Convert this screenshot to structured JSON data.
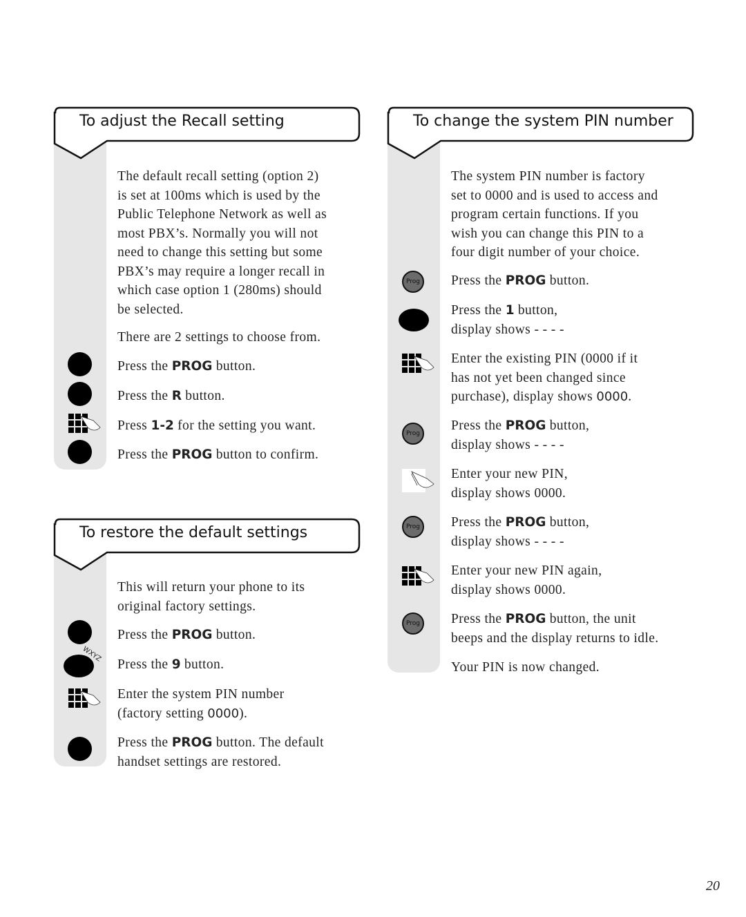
{
  "page_number": "20",
  "left_column": {
    "recall": {
      "title": "To adjust the Recall setting",
      "intro": "The default recall setting (option 2) is set at 100ms which is used by the Public Telephone Network as well as most PBX’s. Normally you will not need to change this setting but some PBX’s may require a longer recall in which case option 1 (280ms) should be selected.",
      "intro_lines": [
        "The default recall setting (option 2)",
        "is set at 100ms which is used by the",
        "Public Telephone Network as well as",
        "most PBX’s. Normally you will not",
        "need to change this setting but some",
        "PBX’s may require a longer recall in",
        "which case option 1 (280ms) should",
        "be selected."
      ],
      "note": "There are 2 settings to choose from.",
      "steps": [
        {
          "icon": "black-button-icon",
          "pre": "Press the ",
          "bold": "PROG",
          "post": " button."
        },
        {
          "icon": "black-button-icon",
          "pre": "Press the ",
          "bold": "R",
          "post": " button."
        },
        {
          "icon": "keypad-icon",
          "pre": "Press ",
          "bold": "1-2",
          "post": " for the setting you want."
        },
        {
          "icon": "black-button-icon",
          "pre": "Press the ",
          "bold": "PROG",
          "post": " button to confirm."
        }
      ]
    },
    "restore": {
      "title": "To restore the default settings",
      "intro_lines": [
        "This will return your phone to its",
        "original factory settings."
      ],
      "steps": [
        {
          "icon": "black-button-icon",
          "pre": "Press the ",
          "bold": "PROG",
          "post": " button."
        },
        {
          "icon": "wxyz-button-icon",
          "label": "WXYZ",
          "pre": "Press the ",
          "bold": "9",
          "post": " button."
        },
        {
          "icon": "keypad-icon",
          "line1": "Enter the system PIN number",
          "line2_pre": "(factory setting ",
          "line2_code": "0000",
          "line2_post": ")."
        },
        {
          "icon": "black-button-icon",
          "pre": "Press the ",
          "bold": "PROG",
          "post": " button. The default",
          "line2": "handset settings are restored."
        }
      ]
    }
  },
  "right_column": {
    "pin": {
      "title": "To change the system PIN number",
      "intro_lines": [
        "The system PIN number is factory",
        "set to 0000 and is used to access and",
        "program certain functions.  If you",
        "wish you can change this PIN to a",
        "four digit number of your choice."
      ],
      "prog_label": "Prog",
      "display_dashes": "- - - -",
      "steps": [
        {
          "icon": "prog-button-icon",
          "pre": "Press the ",
          "bold": "PROG",
          "post": " button."
        },
        {
          "icon": "oval-button-icon",
          "pre": "Press the ",
          "bold": "1",
          "post": " button,",
          "line2": "display shows - - - -"
        },
        {
          "icon": "keypad-icon",
          "line1": "Enter the existing PIN (0000 if it",
          "line2": "has not yet been changed since",
          "line3_pre": "purchase), display shows ",
          "line3_code": "0000",
          "line3_post": "."
        },
        {
          "icon": "prog-button-icon",
          "pre": "Press the ",
          "bold": "PROG",
          "post": " button,",
          "line2": "display shows - - - -"
        },
        {
          "icon": "finger-press-icon",
          "line1": "Enter your new PIN,",
          "line2": "display shows 0000."
        },
        {
          "icon": "prog-button-icon",
          "pre": "Press the ",
          "bold": "PROG",
          "post": " button,",
          "line2": "display shows - - - -"
        },
        {
          "icon": "keypad-icon",
          "line1": "Enter your new PIN again,",
          "line2": "display shows 0000."
        },
        {
          "icon": "prog-button-icon",
          "pre": "Press the ",
          "bold": "PROG",
          "post": " button, the unit",
          "line2": "beeps and the display returns to idle."
        }
      ],
      "outro": "Your PIN is now changed."
    }
  }
}
